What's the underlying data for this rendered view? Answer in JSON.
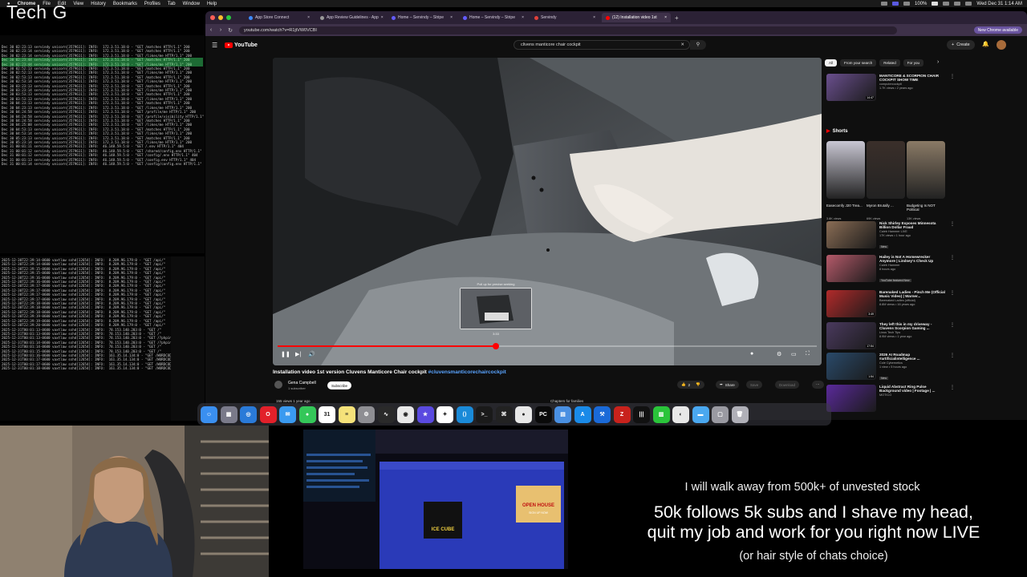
{
  "overlay": {
    "title": "Tech G",
    "walk_away": "I will walk away from 500k+ of unvested stock",
    "follows_line1": "50k follows 5k subs and I shave my head,",
    "follows_line2": "quit my job and work for you right now LIVE",
    "hair_style": "(or hair style of chats choice)"
  },
  "menubar": {
    "items": [
      "Chrome",
      "File",
      "Edit",
      "View",
      "History",
      "Bookmarks",
      "Profiles",
      "Tab",
      "Window",
      "Help"
    ],
    "battery": "100%",
    "clock": "Wed Dec 31  1:14 AM"
  },
  "terminal_top": {
    "lines": [
      "Dec 30 02:23:13 servindy unicorn[3579611]: INFO:  172.3.51.18:0 - \"GET /matches HTTP/1.1\" 200",
      "Dec 30 02:23:14 servindy unicorn[3579611]: INFO:  172.3.51.18:0 - \"GET /matches HTTP/1.1\" 200",
      "Dec 30 02:23:14 servindy unicorn[3579611]: INFO:  172.3.51.18:0 - \"GET /likes/me HTTP/1.1\" 200",
      "Dec 30 02:23:44 servindy unicorn[3579611]: INFO:  172.3.51.18:0 - \"GET /matches HTTP/1.1\" 200",
      "Dec 30 02:23:44 servindy unicorn[3579611]: INFO:  172.3.51.18:0 - \"GET /likes/me HTTP/1.1\" 200",
      "Dec 30 02:52:13 servindy unicorn[3579611]: INFO:  172.3.51.18:0 - \"GET /matches HTTP/1.1\" 200",
      "Dec 30 02:52:13 servindy unicorn[3579611]: INFO:  172.3.51.18:0 - \"GET /likes/me HTTP/1.1\" 200",
      "Dec 30 02:53:13 servindy unicorn[3579611]: INFO:  172.3.51.18:0 - \"GET /matches HTTP/1.1\" 200",
      "Dec 30 02:53:14 servindy unicorn[3579611]: INFO:  172.3.51.18:0 - \"GET /likes/me HTTP/1.1\" 200",
      "Dec 30 03:23:13 servindy unicorn[3579611]: INFO:  172.3.51.18:0 - \"GET /matches HTTP/1.1\" 200",
      "Dec 30 03:23:14 servindy unicorn[3579611]: INFO:  172.3.51.18:0 - \"GET /likes/me HTTP/1.1\" 200",
      "Dec 30 03:53:13 servindy unicorn[3579611]: INFO:  172.3.51.18:0 - \"GET /matches HTTP/1.1\" 200",
      "Dec 30 03:53:13 servindy unicorn[3579611]: INFO:  172.3.51.18:0 - \"GET /likes/me HTTP/1.1\" 200",
      "Dec 30 04:23:13 servindy unicorn[3579611]: INFO:  172.3.51.18:0 - \"GET /matches HTTP/1.1\" 200",
      "Dec 30 04:23:13 servindy unicorn[3579611]: INFO:  172.3.51.18:0 - \"GET /likes/me HTTP/1.1\" 200",
      "Dec 30 04:24:58 servindy unicorn[3579611]: INFO:  172.3.51.18:0 - \"GET /profile/me HTTP/1.1\" 200",
      "Dec 30 04:24:58 servindy unicorn[3579611]: INFO:  172.3.51.18:0 - \"GET /profile/visibility HTTP/1.1\"",
      "Dec 30 04:24:58 servindy unicorn[3579611]: INFO:  172.3.51.18:0 - \"GET /matches HTTP/1.1\" 200",
      "Dec 30 04:25:08 servindy unicorn[3579611]: INFO:  172.3.51.18:0 - \"GET /likes/me HTTP/1.1\" 200",
      "Dec 30 04:53:13 servindy unicorn[3579611]: INFO:  172.3.51.18:0 - \"GET /matches HTTP/1.1\" 200",
      "Dec 30 04:53:14 servindy unicorn[3579611]: INFO:  172.3.51.18:0 - \"GET /likes/me HTTP/1.1\" 200",
      "Dec 30 05:23:13 servindy unicorn[3579611]: INFO:  172.3.51.18:0 - \"GET /matches HTTP/1.1\" 200",
      "Dec 30 05:23:14 servindy unicorn[3579611]: INFO:  172.3.51.18:0 - \"GET /likes/me HTTP/1.1\" 200",
      "Dec 31 00:01:11 servindy unicorn[3579611]: INFO:  46.148.59.5:0 - \"GET /.env HTTP/1.1\" 404",
      "Dec 31 00:01:12 servindy unicorn[3579611]: INFO:  46.148.59.5:0 - \"GET /shared/config.env HTTP/1.1\"",
      "Dec 31 00:01:12 servindy unicorn[3579611]: INFO:  46.148.59.5:0 - \"GET /config/.env HTTP/1.1\" 404",
      "Dec 31 00:01:13 servindy unicorn[3579611]: INFO:  46.148.59.5:0 - \"GET /config.env HTTP/1.1\" 404",
      "Dec 31 00:01:14 servindy unicorn[3579611]: INFO:  46.148.59.5:0 - \"GET /config/config.env HTTP/1.1\""
    ]
  },
  "terminal_bottom": {
    "lines": [
      "2025-12-30T22:39:14-0600 vaxtlaw sshd[12654]: INFO:  8.209.96.179:0 - \"GET /api/\"",
      "2025-12-30T22:39:14-0600 vaxtlaw sshd[12654]: INFO:  8.209.96.179:0 - \"GET /api/\"",
      "2025-12-30T22:39:15-0600 vaxtlaw sshd[12654]: INFO:  8.209.96.179:0 - \"GET /api/\"",
      "2025-12-30T22:39:15-0600 vaxtlaw sshd[12654]: INFO:  8.209.96.179:0 - \"GET /api/\"",
      "2025-12-30T22:39:16-0600 vaxtlaw sshd[12654]: INFO:  8.209.96.179:0 - \"GET /api/\"",
      "2025-12-30T22:39:16-0600 vaxtlaw sshd[12654]: INFO:  8.209.96.179:0 - \"GET /api/\"",
      "2025-12-30T22:39:17-0600 vaxtlaw sshd[12654]: INFO:  8.209.96.179:0 - \"GET /api/\"",
      "2025-12-30T22:39:17-0600 vaxtlaw sshd[12654]: INFO:  8.209.96.179:0 - \"GET /api/\"",
      "2025-12-30T22:39:17-0600 vaxtlaw sshd[12654]: INFO:  8.209.96.179:0 - \"GET /api/\"",
      "2025-12-30T22:39:17-0600 vaxtlaw sshd[12654]: INFO:  8.209.96.179:0 - \"GET /api/\"",
      "2025-12-30T22:39:18-0600 vaxtlaw sshd[12654]: INFO:  8.209.96.179:0 - \"GET /api/\"",
      "2025-12-30T22:39:18-0600 vaxtlaw sshd[12654]: INFO:  8.209.96.179:0 - \"GET /api/\"",
      "2025-12-30T22:39:18-0600 vaxtlaw sshd[12654]: INFO:  8.209.96.179:0 - \"GET /api/\"",
      "2025-12-30T22:39:19-0600 vaxtlaw sshd[12654]: INFO:  8.209.96.179:0 - \"GET /api/\"",
      "2025-12-30T22:39:19-0600 vaxtlaw sshd[12654]: INFO:  8.209.96.179:0 - \"GET /api/\"",
      "2025-12-30T22:39:20-0600 vaxtlaw sshd[12654]: INFO:  8.209.96.179:0 - \"GET /api/\"",
      "2025-12-31T00:01:13-0600 vaxtlaw sshd[12654]: INFO:  78.153.140.203:0 - \"GET /\"",
      "2025-12-31T00:01:13-0600 vaxtlaw sshd[12654]: INFO:  78.153.140.203:0 - \"GET /\"",
      "2025-12-31T00:01:13-0600 vaxtlaw sshd[12654]: INFO:  78.153.140.203:0 - \"GET /?phpinfo=-1 HTTP\"",
      "2025-12-31T00:01:14-0600 vaxtlaw sshd[12654]: INFO:  78.153.140.203:0 - \"GET /?phpinfo=-1 HTTP\"",
      "2025-12-31T00:01:14-0600 vaxtlaw sshd[12654]: INFO:  78.153.140.203:0 - \"GET /\"",
      "2025-12-31T00:01:15-0600 vaxtlaw sshd[12654]: INFO:  78.153.140.203:0 - \"GET /\"",
      "2025-12-31T00:01:16-0600 vaxtlaw sshd[12654]: INFO:  161.35.14.134:0 - \"GET /WORDCODE/HTTP\"",
      "2025-12-31T00:01:17-0600 vaxtlaw sshd[12654]: INFO:  161.35.14.134:0 - \"GET /WORDCODE/HTTP\"",
      "2025-12-31T00:01:17-0600 vaxtlaw sshd[12654]: INFO:  161.35.14.134:0 - \"GET /WORDCODE/HTTP\"",
      "2025-12-31T00:01:18-0600 vaxtlaw sshd[12654]: INFO:  161.35.14.134:0 - \"GET /WORDCODE/HTTP\""
    ]
  },
  "browser": {
    "tabs": [
      {
        "label": "App Store Connect",
        "color": "#3d8bff"
      },
      {
        "label": "App Review Guidelines - App",
        "color": "#999999"
      },
      {
        "label": "Home – Servindy – Stripe",
        "color": "#635bff"
      },
      {
        "label": "Home – Servindy – Stripe",
        "color": "#635bff"
      },
      {
        "label": "Servindy",
        "color": "#e0403a"
      },
      {
        "label": "(12) Installation video 1st",
        "color": "#ff0000"
      }
    ],
    "url": "youtube.com/watch?v=R1jtVW0VCBI",
    "new_chrome": "New Chrome available"
  },
  "youtube": {
    "logo": "YouTube",
    "search_query": "clivens manticore chair cockpit",
    "create_label": "Create",
    "video": {
      "preview_caption": "Pull up for precise seeking",
      "preview_time": "3:33",
      "progress": 0.405,
      "title": "Installation video 1st version Cluvens Manticore Chair cockpit ",
      "hashtag": "#cluvensmanticorechaircockpit",
      "channel": "Gena Campbell",
      "subscribers": "1 subscriber",
      "subscribe_label": "Subscribe",
      "likes": "2",
      "share_label": "Share",
      "save_label": "Save",
      "download_label": "Download",
      "views_line": "155 views  1 year ago",
      "chapters_line": "Chapters for families"
    },
    "chips": [
      "All",
      "From your search",
      "Related",
      "For you"
    ],
    "recommendations_top": [
      {
        "title": "MANTICORE & SCORPION CHAIR COCKPIT SHOW TIME",
        "channel": "computercockpit",
        "meta": "1.7K views • 2 years ago",
        "duration": "14:47",
        "color": "#6a4f8e"
      }
    ],
    "shorts_label": "Shorts",
    "shorts": [
      {
        "title": "Easecomfy J20 Trea...",
        "views": "3.8K views",
        "color": "#c9c7d3"
      },
      {
        "title": "Myron Brutally ...",
        "views": "69K views",
        "color": "#3a2f2a"
      },
      {
        "title": "Budgeting Is NOT Political",
        "views": "13K views",
        "color": "#8a7a66"
      }
    ],
    "recommendations": [
      {
        "title": "Nick Shirley Exposes Minnesota Billion Dollar Fraud",
        "channel": "Caleb Hammer LIVE",
        "meta": "17K views • 1 hour ago",
        "badge": "New",
        "duration": "",
        "color": "#8a6d55"
      },
      {
        "title": "Hailey is Not A Homewrecker Anymore | Lindsey's Check Up",
        "channel": "Caleb Hammer",
        "meta": "8 hours ago",
        "badge": "YouTube featured  New",
        "duration": "",
        "color": "#b55a6a"
      },
      {
        "title": "Barenaked Ladies - Pinch Me (Official Music Video) | Warner...",
        "channel": "Barenaked Ladies (official)",
        "meta": "8.8M views • 16 years ago",
        "badge": "",
        "duration": "3:49",
        "color": "#b12a2a"
      },
      {
        "title": "They left this in my driveway - Cluvens Scorpion Gaming ...",
        "channel": "Linus Tech Tips",
        "meta": "8.9M views • 1 year ago",
        "badge": "",
        "duration": "17:54",
        "color": "#4a3a5e"
      },
      {
        "title": "2026 AI Roadmap #artificialintelligence ...",
        "channel": "Cole Cybernetics",
        "meta": "1 view • 5 hours ago",
        "badge": "New",
        "duration": "1:54",
        "color": "#2a4a6a"
      },
      {
        "title": "Liquid Abstract Ring Pulse Background video | Footage | ...",
        "channel": "MOTICO",
        "meta": "",
        "badge": "",
        "duration": "",
        "color": "#5a2a9a"
      }
    ]
  },
  "dock": {
    "apps": [
      {
        "name": "finder",
        "color": "#3a8ff0",
        "glyph": "☺"
      },
      {
        "name": "launchpad",
        "color": "#7a7a8a",
        "glyph": "▦"
      },
      {
        "name": "safari",
        "color": "#2a7ad8",
        "glyph": "◎"
      },
      {
        "name": "opera",
        "color": "#e2202a",
        "glyph": "O"
      },
      {
        "name": "mail",
        "color": "#3a9af0",
        "glyph": "✉"
      },
      {
        "name": "messages",
        "color": "#34c759",
        "glyph": "●"
      },
      {
        "name": "calendar",
        "color": "#ffffff",
        "glyph": "31"
      },
      {
        "name": "notes",
        "color": "#f5e27a",
        "glyph": "≡"
      },
      {
        "name": "settings",
        "color": "#8e8e93",
        "glyph": "⚙"
      },
      {
        "name": "activity-monitor",
        "color": "#2a2a2a",
        "glyph": "∿"
      },
      {
        "name": "chrome",
        "color": "#e9e9e9",
        "glyph": "◉"
      },
      {
        "name": "bookmarks",
        "color": "#5a4ae0",
        "glyph": "★"
      },
      {
        "name": "chatgpt",
        "color": "#ffffff",
        "glyph": "✦"
      },
      {
        "name": "vscode",
        "color": "#1a8ad8",
        "glyph": "⟨⟩"
      },
      {
        "name": "terminal",
        "color": "#1a1a1a",
        "glyph": ">_"
      },
      {
        "name": "openai",
        "color": "#222222",
        "glyph": "⌘"
      },
      {
        "name": "github",
        "color": "#e8e8e8",
        "glyph": "●"
      },
      {
        "name": "pycharm",
        "color": "#0a0a0a",
        "glyph": "PC"
      },
      {
        "name": "app-generic",
        "color": "#4a90e2",
        "glyph": "▤"
      },
      {
        "name": "app-store",
        "color": "#1a8ae8",
        "glyph": "A"
      },
      {
        "name": "xcode",
        "color": "#1a6ad8",
        "glyph": "⚒"
      },
      {
        "name": "filezilla",
        "color": "#c8221c",
        "glyph": "Z"
      },
      {
        "name": "ableton",
        "color": "#111111",
        "glyph": "|||"
      },
      {
        "name": "numbers",
        "color": "#2ac43a",
        "glyph": "▥"
      },
      {
        "name": "browser",
        "color": "#e8e8e8",
        "glyph": "◐"
      },
      {
        "name": "folder",
        "color": "#4aa8f0",
        "glyph": "▬"
      },
      {
        "name": "preview",
        "color": "#9a9aa2",
        "glyph": "▢"
      },
      {
        "name": "trash",
        "color": "#b0b0b8",
        "glyph": "🗑"
      }
    ]
  },
  "mini_share": {
    "album_title": "ICE CUBE",
    "promo": "OPEN HOUSE",
    "promo_sub": "SIGN UP NOW"
  }
}
